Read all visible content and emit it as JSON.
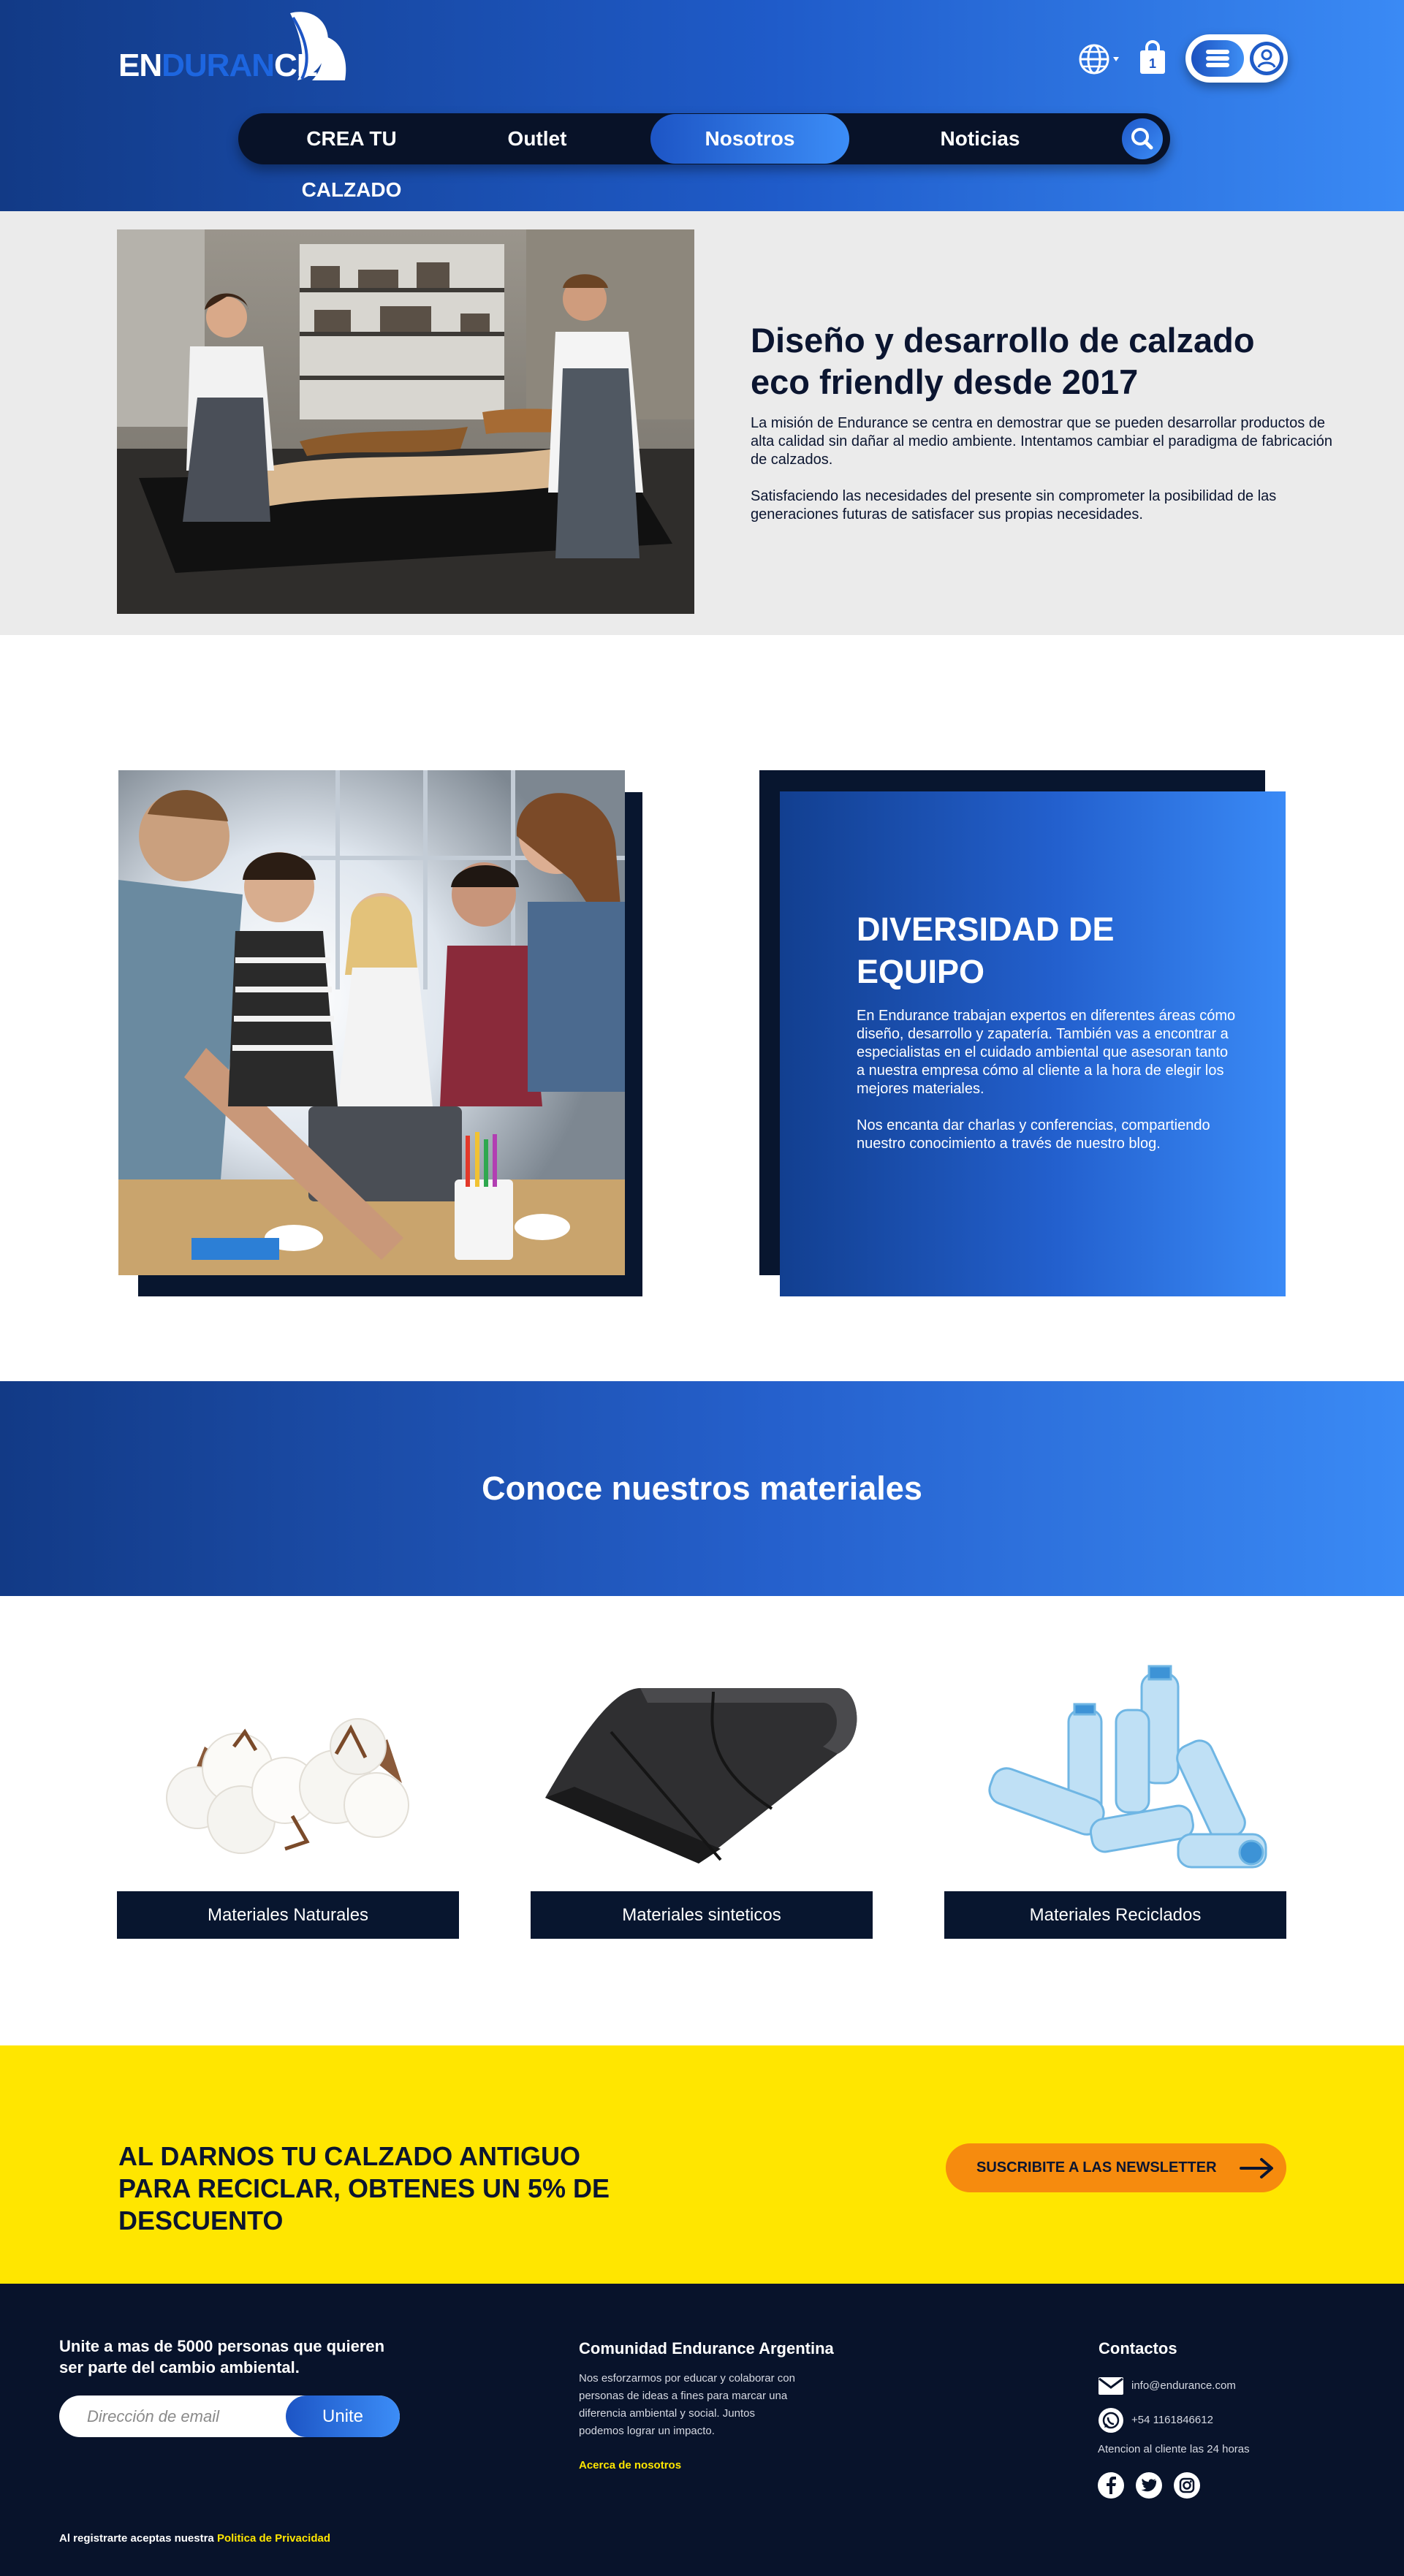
{
  "header": {
    "logo": {
      "part1": "EN",
      "part2": "DURAN",
      "part3": "CE"
    },
    "nav": [
      {
        "label": "CREA TU CALZADO",
        "active": false
      },
      {
        "label": "Outlet",
        "active": false
      },
      {
        "label": "Nosotros",
        "active": true
      },
      {
        "label": "Noticias",
        "active": false
      }
    ],
    "icons": [
      "globe-icon",
      "cart-bag-icon",
      "menu-icon",
      "user-icon",
      "search-icon"
    ]
  },
  "mission": {
    "title_line1": "Diseño y desarrollo de calzado",
    "title_line2": "eco friendly desde 2017",
    "paragraph1": "La misión de Endurance se centra en demostrar que se pueden desarrollar productos de alta calidad sin dañar al medio ambiente. Intentamos cambiar el paradigma de fabricación de calzados.",
    "paragraph2": "Satisfaciendo las necesidades del presente sin comprometer la posibilidad de las generaciones futuras de satisfacer sus propias necesidades."
  },
  "diversity": {
    "title_line1": "DIVERSIDAD DE",
    "title_line2": "EQUIPO",
    "paragraph1": "En Endurance trabajan expertos en diferentes áreas cómo diseño, desarrollo y zapatería. También vas a encontrar a especialistas en el cuidado ambiental que asesoran tanto a nuestra empresa cómo al cliente a la hora de elegir los mejores materiales.",
    "paragraph2": "Nos encanta dar charlas y conferencias, compartiendo nuestro conocimiento a través de nuestro blog."
  },
  "materials": {
    "title": "Conoce nuestros materiales",
    "items": [
      {
        "label": "Materiales Naturales",
        "icon": "cotton-image"
      },
      {
        "label": "Materiales sinteticos",
        "icon": "synthetic-sheet-image"
      },
      {
        "label": "Materiales Reciclados",
        "icon": "plastic-bottles-image"
      }
    ]
  },
  "promo": {
    "line1": "AL DARNOS TU CALZADO ANTIGUO",
    "line2": "PARA RECICLAR, OBTENES UN 5% DE DESCUENTO",
    "button": "SUSCRIBITE A LAS NEWSLETTER"
  },
  "footer": {
    "join_line1": "Unite a mas de 5000 personas que quieren",
    "join_line2": "ser parte del cambio ambiental.",
    "email_placeholder": "Dirección de email",
    "submit": "Unite",
    "community_title": "Comunidad Endurance Argentina",
    "community_text_1": "Nos esforzarmos por educar y colaborar con",
    "community_text_2": "personas de ideas a fines para marcar una",
    "community_text_3": "diferencia ambiental y social. Juntos",
    "community_text_4": "podemos lograr un impacto.",
    "about_link": "Acerca de nosotros",
    "contacts_title": "Contactos",
    "email": "info@endurance.com",
    "phone": "+54 1161846612",
    "hours": "Atencion al cliente las 24 horas",
    "legal_prefix": "Al registrarte aceptas nuestra",
    "legal_link": "Politica de Privacidad"
  },
  "colors": {
    "navy": "#08132b",
    "blue_start": "#123a86",
    "blue_end": "#3a8af5",
    "yellow": "#ffe600",
    "orange": "#f68b0e"
  }
}
